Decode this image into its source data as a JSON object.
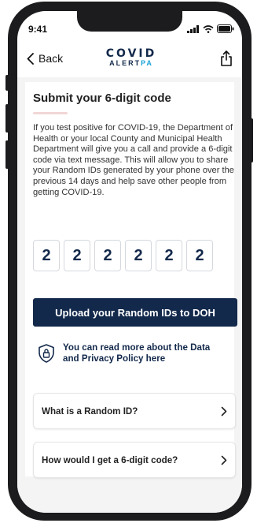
{
  "status_bar": {
    "time": "9:41"
  },
  "nav": {
    "back_label": "Back",
    "logo_top": "COVID",
    "logo_bottom_a": "ALERT",
    "logo_bottom_b": "PA"
  },
  "page": {
    "title": "Submit your 6-digit code",
    "description": "If you test positive for COVID-19, the Department of Health or your local County and Municipal Health Department will give you a call and provide a 6-digit code via text message. This will allow you to share your Random IDs generated by your phone over the previous 14 days and help save other people from getting COVID-19.",
    "code_digits": [
      "2",
      "2",
      "2",
      "2",
      "2",
      "2"
    ],
    "upload_button": "Upload your Random IDs to DOH",
    "privacy_link": "You can read more about the Data and Privacy Policy here",
    "faq": [
      {
        "label": "What is a Random ID?"
      },
      {
        "label": "How would I get a 6-digit code?"
      }
    ]
  },
  "colors": {
    "navy": "#13294b",
    "accent": "#1aa1d6"
  }
}
